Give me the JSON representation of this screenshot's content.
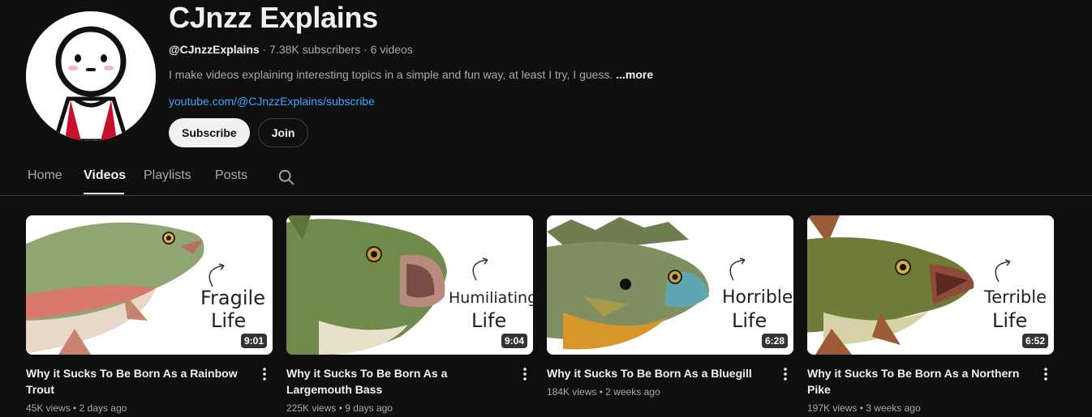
{
  "channel": {
    "name": "CJnzz Explains",
    "handle": "@CJnzzExplains",
    "subscribers": "7.38K subscribers",
    "video_count": "6 videos",
    "separator": "·",
    "description": "I make videos explaining interesting topics in a simple and fun way, at least I try, I guess.",
    "more_label": "...more",
    "link": "youtube.com/@CJnzzExplains/subscribe",
    "subscribe_label": "Subscribe",
    "join_label": "Join"
  },
  "tabs": [
    {
      "label": "Home"
    },
    {
      "label": "Videos"
    },
    {
      "label": "Playlists"
    },
    {
      "label": "Posts"
    }
  ],
  "videos": [
    {
      "title": "Why it Sucks To Be Born As a Rainbow Trout",
      "views": "45K views",
      "age": "2 days ago",
      "duration": "9:01",
      "thumb_line1": "Fragile",
      "thumb_line2": "Life"
    },
    {
      "title": "Why it Sucks To Be Born As a Largemouth Bass",
      "views": "225K views",
      "age": "9 days ago",
      "duration": "9:04",
      "thumb_line1": "Humiliating",
      "thumb_line2": "Life"
    },
    {
      "title": "Why it Sucks To Be Born As a Bluegill",
      "views": "184K views",
      "age": "2 weeks ago",
      "duration": "6:28",
      "thumb_line1": "Horrible",
      "thumb_line2": "Life"
    },
    {
      "title": "Why it Sucks To Be Born As a Northern Pike",
      "views": "197K views",
      "age": "3 weeks ago",
      "duration": "6:52",
      "thumb_line1": "Terrible",
      "thumb_line2": "Life"
    }
  ],
  "meta_separator": "•",
  "colors": {
    "background": "#0f0f0f",
    "link": "#3ea6ff",
    "text": "#f1f1f1",
    "muted": "#aaaaaa"
  },
  "icons": {
    "search": "search-icon",
    "more_options": "kebab-icon"
  }
}
